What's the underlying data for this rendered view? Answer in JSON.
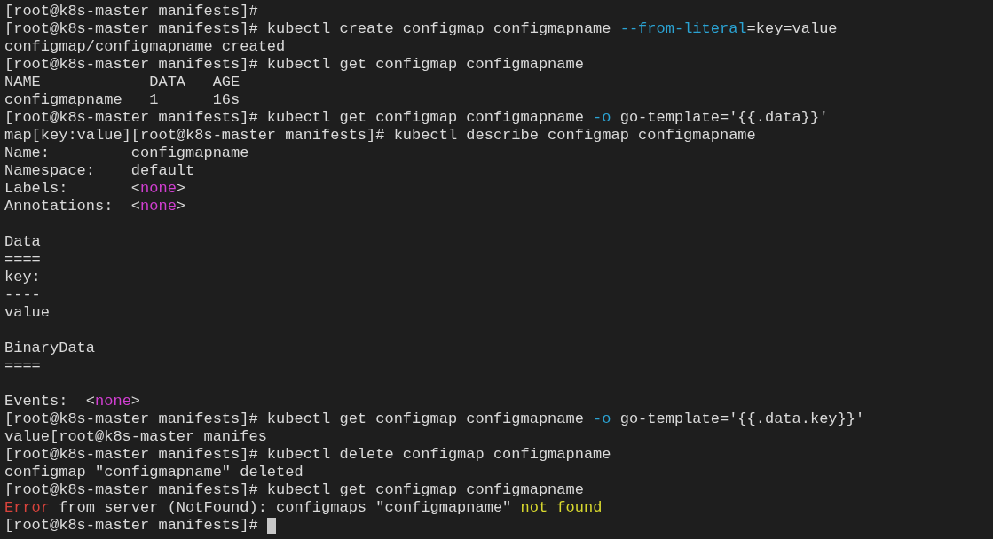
{
  "terminal": {
    "cursor": true,
    "lines": [
      {
        "kind": "text",
        "segments": [
          {
            "text": "[root@k8s-master manifests]#"
          }
        ]
      },
      {
        "kind": "text",
        "segments": [
          {
            "text": "[root@k8s-master manifests]# kubectl create configmap configmapname "
          },
          {
            "text": "--from-literal",
            "color": "#2ba3d3"
          },
          {
            "text": "=key=value"
          }
        ]
      },
      {
        "kind": "text",
        "segments": [
          {
            "text": "configmap/configmapname created"
          }
        ]
      },
      {
        "kind": "text",
        "segments": [
          {
            "text": "[root@k8s-master manifests]# kubectl get configmap configmapname"
          }
        ]
      },
      {
        "kind": "text",
        "segments": [
          {
            "text": "NAME            DATA   AGE"
          }
        ]
      },
      {
        "kind": "text",
        "segments": [
          {
            "text": "configmapname   1      16s"
          }
        ]
      },
      {
        "kind": "text",
        "segments": [
          {
            "text": "[root@k8s-master manifests]# kubectl get configmap configmapname "
          },
          {
            "text": "-o",
            "color": "#2ba3d3"
          },
          {
            "text": " go-template='{{.data}}'"
          }
        ]
      },
      {
        "kind": "text",
        "segments": [
          {
            "text": "map[key:value][root@k8s-master manifests]# kubectl describe configmap configmapname"
          }
        ]
      },
      {
        "kind": "text",
        "segments": [
          {
            "text": "Name:         configmapname"
          }
        ]
      },
      {
        "kind": "text",
        "segments": [
          {
            "text": "Namespace:    default"
          }
        ]
      },
      {
        "kind": "text",
        "segments": [
          {
            "text": "Labels:       <"
          },
          {
            "text": "none",
            "color": "#d23fd2"
          },
          {
            "text": ">"
          }
        ]
      },
      {
        "kind": "text",
        "segments": [
          {
            "text": "Annotations:  <"
          },
          {
            "text": "none",
            "color": "#d23fd2"
          },
          {
            "text": ">"
          }
        ]
      },
      {
        "kind": "blank"
      },
      {
        "kind": "text",
        "segments": [
          {
            "text": "Data"
          }
        ]
      },
      {
        "kind": "text",
        "segments": [
          {
            "text": "===="
          }
        ]
      },
      {
        "kind": "text",
        "segments": [
          {
            "text": "key:"
          }
        ]
      },
      {
        "kind": "text",
        "segments": [
          {
            "text": "----"
          }
        ]
      },
      {
        "kind": "text",
        "segments": [
          {
            "text": "value"
          }
        ]
      },
      {
        "kind": "blank"
      },
      {
        "kind": "text",
        "segments": [
          {
            "text": "BinaryData"
          }
        ]
      },
      {
        "kind": "text",
        "segments": [
          {
            "text": "===="
          }
        ]
      },
      {
        "kind": "blank"
      },
      {
        "kind": "text",
        "segments": [
          {
            "text": "Events:  <"
          },
          {
            "text": "none",
            "color": "#d23fd2"
          },
          {
            "text": ">"
          }
        ]
      },
      {
        "kind": "text",
        "segments": [
          {
            "text": "[root@k8s-master manifests]# kubectl get configmap configmapname "
          },
          {
            "text": "-o",
            "color": "#2ba3d3"
          },
          {
            "text": " go-template='{{.data.key}}'"
          }
        ]
      },
      {
        "kind": "text",
        "segments": [
          {
            "text": "value[root@k8s-master manifes"
          }
        ]
      },
      {
        "kind": "text",
        "segments": [
          {
            "text": "[root@k8s-master manifests]# kubectl delete configmap configmapname"
          }
        ]
      },
      {
        "kind": "text",
        "segments": [
          {
            "text": "configmap \"configmapname\" deleted"
          }
        ]
      },
      {
        "kind": "text",
        "segments": [
          {
            "text": "[root@k8s-master manifests]# kubectl get configmap configmapname"
          }
        ]
      },
      {
        "kind": "text",
        "segments": [
          {
            "text": "Error",
            "color": "#d9433c"
          },
          {
            "text": " from server (NotFound): configmaps \"configmapname\" "
          },
          {
            "text": "not found",
            "color": "#d8d82e"
          }
        ]
      },
      {
        "kind": "text",
        "segments": [
          {
            "text": "[root@k8s-master manifests]# "
          }
        ]
      }
    ]
  }
}
